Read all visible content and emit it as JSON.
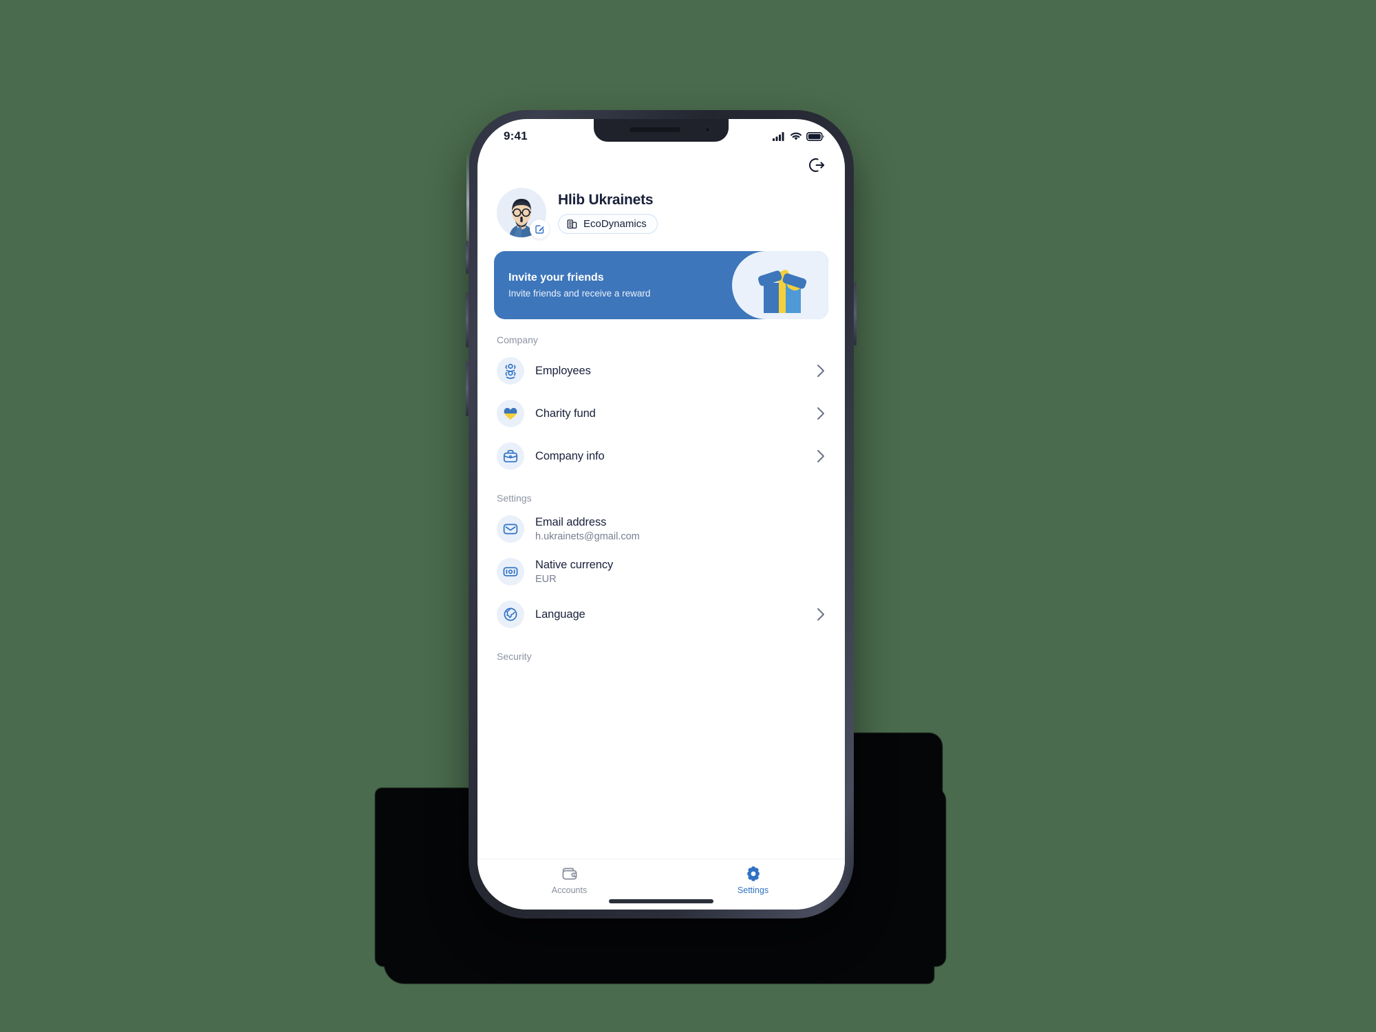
{
  "status_bar": {
    "time": "9:41",
    "icons": [
      "cellular-signal-icon",
      "wifi-icon",
      "battery-icon"
    ]
  },
  "top_bar": {
    "logout_icon": "logout-icon"
  },
  "profile": {
    "name": "Hlib Ukrainets",
    "company": "EcoDynamics",
    "company_icon": "building-icon",
    "avatar_icon": "user-avatar",
    "edit_icon": "edit-pencil-icon"
  },
  "invite_banner": {
    "title": "Invite your friends",
    "subtitle": "Invite friends and receive a reward",
    "art_icon": "gift-box-icon"
  },
  "sections": [
    {
      "header": "Company",
      "items": [
        {
          "title": "Employees",
          "subtitle": "",
          "icon": "people-icon",
          "chevron": true
        },
        {
          "title": "Charity fund",
          "subtitle": "",
          "icon": "heart-flag-icon",
          "chevron": true
        },
        {
          "title": "Company info",
          "subtitle": "",
          "icon": "briefcase-icon",
          "chevron": true
        }
      ]
    },
    {
      "header": "Settings",
      "items": [
        {
          "title": "Email address",
          "subtitle": "h.ukrainets@gmail.com",
          "icon": "envelope-icon",
          "chevron": false
        },
        {
          "title": "Native currency",
          "subtitle": "EUR",
          "icon": "banknote-icon",
          "chevron": false
        },
        {
          "title": "Language",
          "subtitle": "",
          "icon": "globe-icon",
          "chevron": true
        }
      ]
    },
    {
      "header": "Security",
      "items": []
    }
  ],
  "tab_bar": {
    "tabs": [
      {
        "label": "Accounts",
        "icon": "wallet-icon",
        "active": false
      },
      {
        "label": "Settings",
        "icon": "gear-icon",
        "active": true
      }
    ]
  },
  "colors": {
    "background": "#4a6b4d",
    "accent": "#2f72c4",
    "banner": "#3d76bb",
    "icon_bg": "#e9f0fa",
    "text": "#18203a",
    "muted": "#8c93a3",
    "ribbon_yellow": "#f5d03a"
  }
}
